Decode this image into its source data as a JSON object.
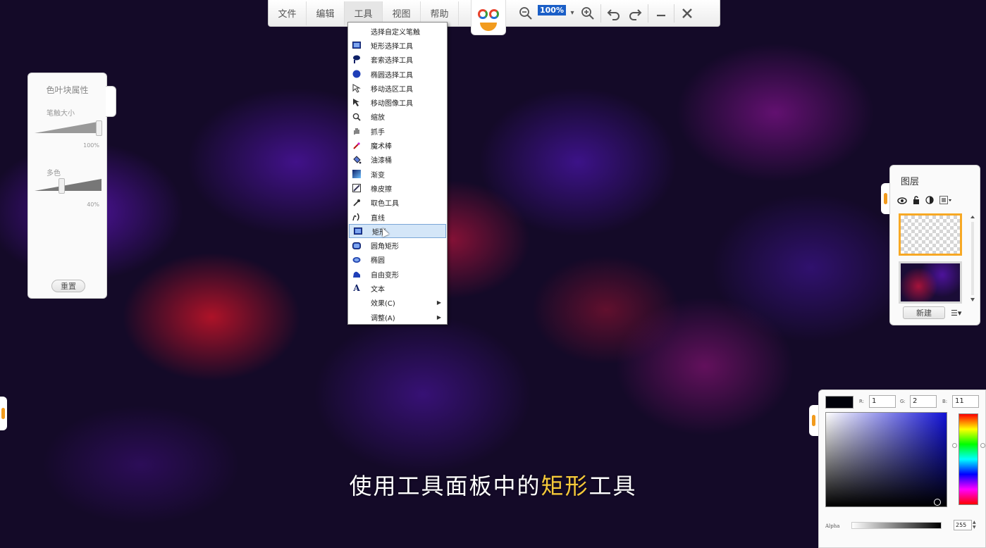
{
  "toolbar": {
    "menus": [
      "文件",
      "编辑",
      "工具",
      "视图",
      "帮助"
    ],
    "active_menu": "工具",
    "zoom_out_icon": "zoom-out-icon",
    "zoom_value": "100%",
    "zoom_in_icon": "zoom-in-icon",
    "undo_icon": "undo-icon",
    "redo_icon": "redo-icon",
    "minimize_icon": "minimize-icon",
    "close_icon": "close-icon",
    "zoom_badge_color": "#1b5fc7"
  },
  "tools_menu": {
    "items": [
      {
        "label": "选择自定义笔触",
        "icon": "",
        "has_submenu": false
      },
      {
        "label": "矩形选择工具",
        "icon": "rect-select-icon",
        "has_submenu": false
      },
      {
        "label": "套索选择工具",
        "icon": "lasso-select-icon",
        "has_submenu": false
      },
      {
        "label": "椭圆选择工具",
        "icon": "ellipse-select-icon",
        "has_submenu": false
      },
      {
        "label": "移动选区工具",
        "icon": "move-selection-icon",
        "has_submenu": false
      },
      {
        "label": "移动图像工具",
        "icon": "move-image-icon",
        "has_submenu": false
      },
      {
        "label": "缩放",
        "icon": "zoom-icon",
        "has_submenu": false
      },
      {
        "label": "抓手",
        "icon": "hand-icon",
        "has_submenu": false
      },
      {
        "label": "魔术棒",
        "icon": "magic-wand-icon",
        "has_submenu": false
      },
      {
        "label": "油漆桶",
        "icon": "paint-bucket-icon",
        "has_submenu": false
      },
      {
        "label": "渐变",
        "icon": "gradient-icon",
        "has_submenu": false
      },
      {
        "label": "橡皮擦",
        "icon": "eraser-icon",
        "has_submenu": false
      },
      {
        "label": "取色工具",
        "icon": "color-picker-icon",
        "has_submenu": false
      },
      {
        "label": "直线",
        "icon": "line-icon",
        "has_submenu": false
      },
      {
        "label": "矩形",
        "icon": "rectangle-icon",
        "has_submenu": false,
        "selected": true
      },
      {
        "label": "圆角矩形",
        "icon": "rounded-rect-icon",
        "has_submenu": false
      },
      {
        "label": "椭圆",
        "icon": "ellipse-icon",
        "has_submenu": false
      },
      {
        "label": "自由变形",
        "icon": "freeform-icon",
        "has_submenu": false
      },
      {
        "label": "文本",
        "icon": "text-icon",
        "has_submenu": false
      },
      {
        "label": "效果(C)",
        "icon": "",
        "has_submenu": true
      },
      {
        "label": "调整(A)",
        "icon": "",
        "has_submenu": true
      }
    ],
    "selected_color": "#d4e6f8"
  },
  "properties_panel": {
    "title": "色叶块属性",
    "brush_size_label": "笔触大小",
    "brush_size_value": "100%",
    "opacity_label": "多色",
    "opacity_value": "40%",
    "reset_button": "重置"
  },
  "layers_panel": {
    "title": "图层",
    "new_button": "新建",
    "icons": [
      "eye-icon",
      "lock-icon",
      "contrast-icon",
      "layer-menu-icon"
    ],
    "selected_border_color": "#f7a824"
  },
  "color_panel": {
    "current_color": "#01020b",
    "r_label": "R:",
    "r_value": "1",
    "g_label": "G:",
    "g_value": "2",
    "b_label": "B:",
    "b_value": "11",
    "alpha_label": "Alpha",
    "alpha_value": "255"
  },
  "caption": {
    "prefix": "使用工具面板中的",
    "highlight": "矩形",
    "suffix": "工具",
    "highlight_color": "#f6c93a"
  },
  "accent_color": "#f29b1d"
}
